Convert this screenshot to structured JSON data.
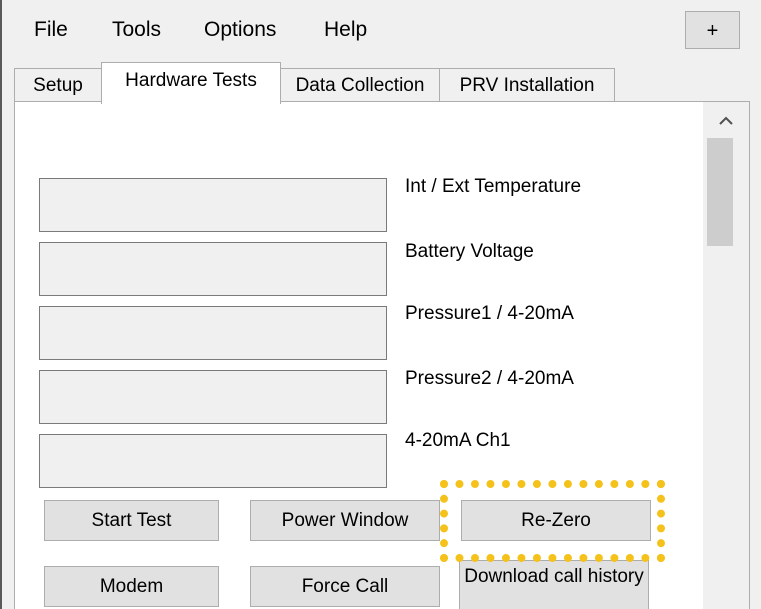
{
  "menu": {
    "items": [
      "File",
      "Tools",
      "Options",
      "Help"
    ],
    "plus_label": "+"
  },
  "tabs": [
    {
      "label": "Setup",
      "active": false
    },
    {
      "label": "Hardware Tests",
      "active": true
    },
    {
      "label": "Data Collection",
      "active": false
    },
    {
      "label": "PRV Installation",
      "active": false
    }
  ],
  "readouts": [
    {
      "label": "Int / Ext Temperature",
      "value": ""
    },
    {
      "label": "Battery Voltage",
      "value": ""
    },
    {
      "label": "Pressure1 / 4-20mA",
      "value": ""
    },
    {
      "label": "Pressure2 / 4-20mA",
      "value": ""
    },
    {
      "label": "4-20mA Ch1",
      "value": ""
    }
  ],
  "buttons": {
    "start_test": "Start Test",
    "power_window": "Power Window",
    "re_zero": "Re-Zero",
    "modem": "Modem",
    "force_call": "Force Call",
    "download_call_history": "Download call history"
  },
  "highlight": {
    "color": "#f5c21b",
    "style": "dotted",
    "target": "re-zero-button"
  },
  "scrollbar": {
    "up_icon": "chevron-up-icon"
  }
}
